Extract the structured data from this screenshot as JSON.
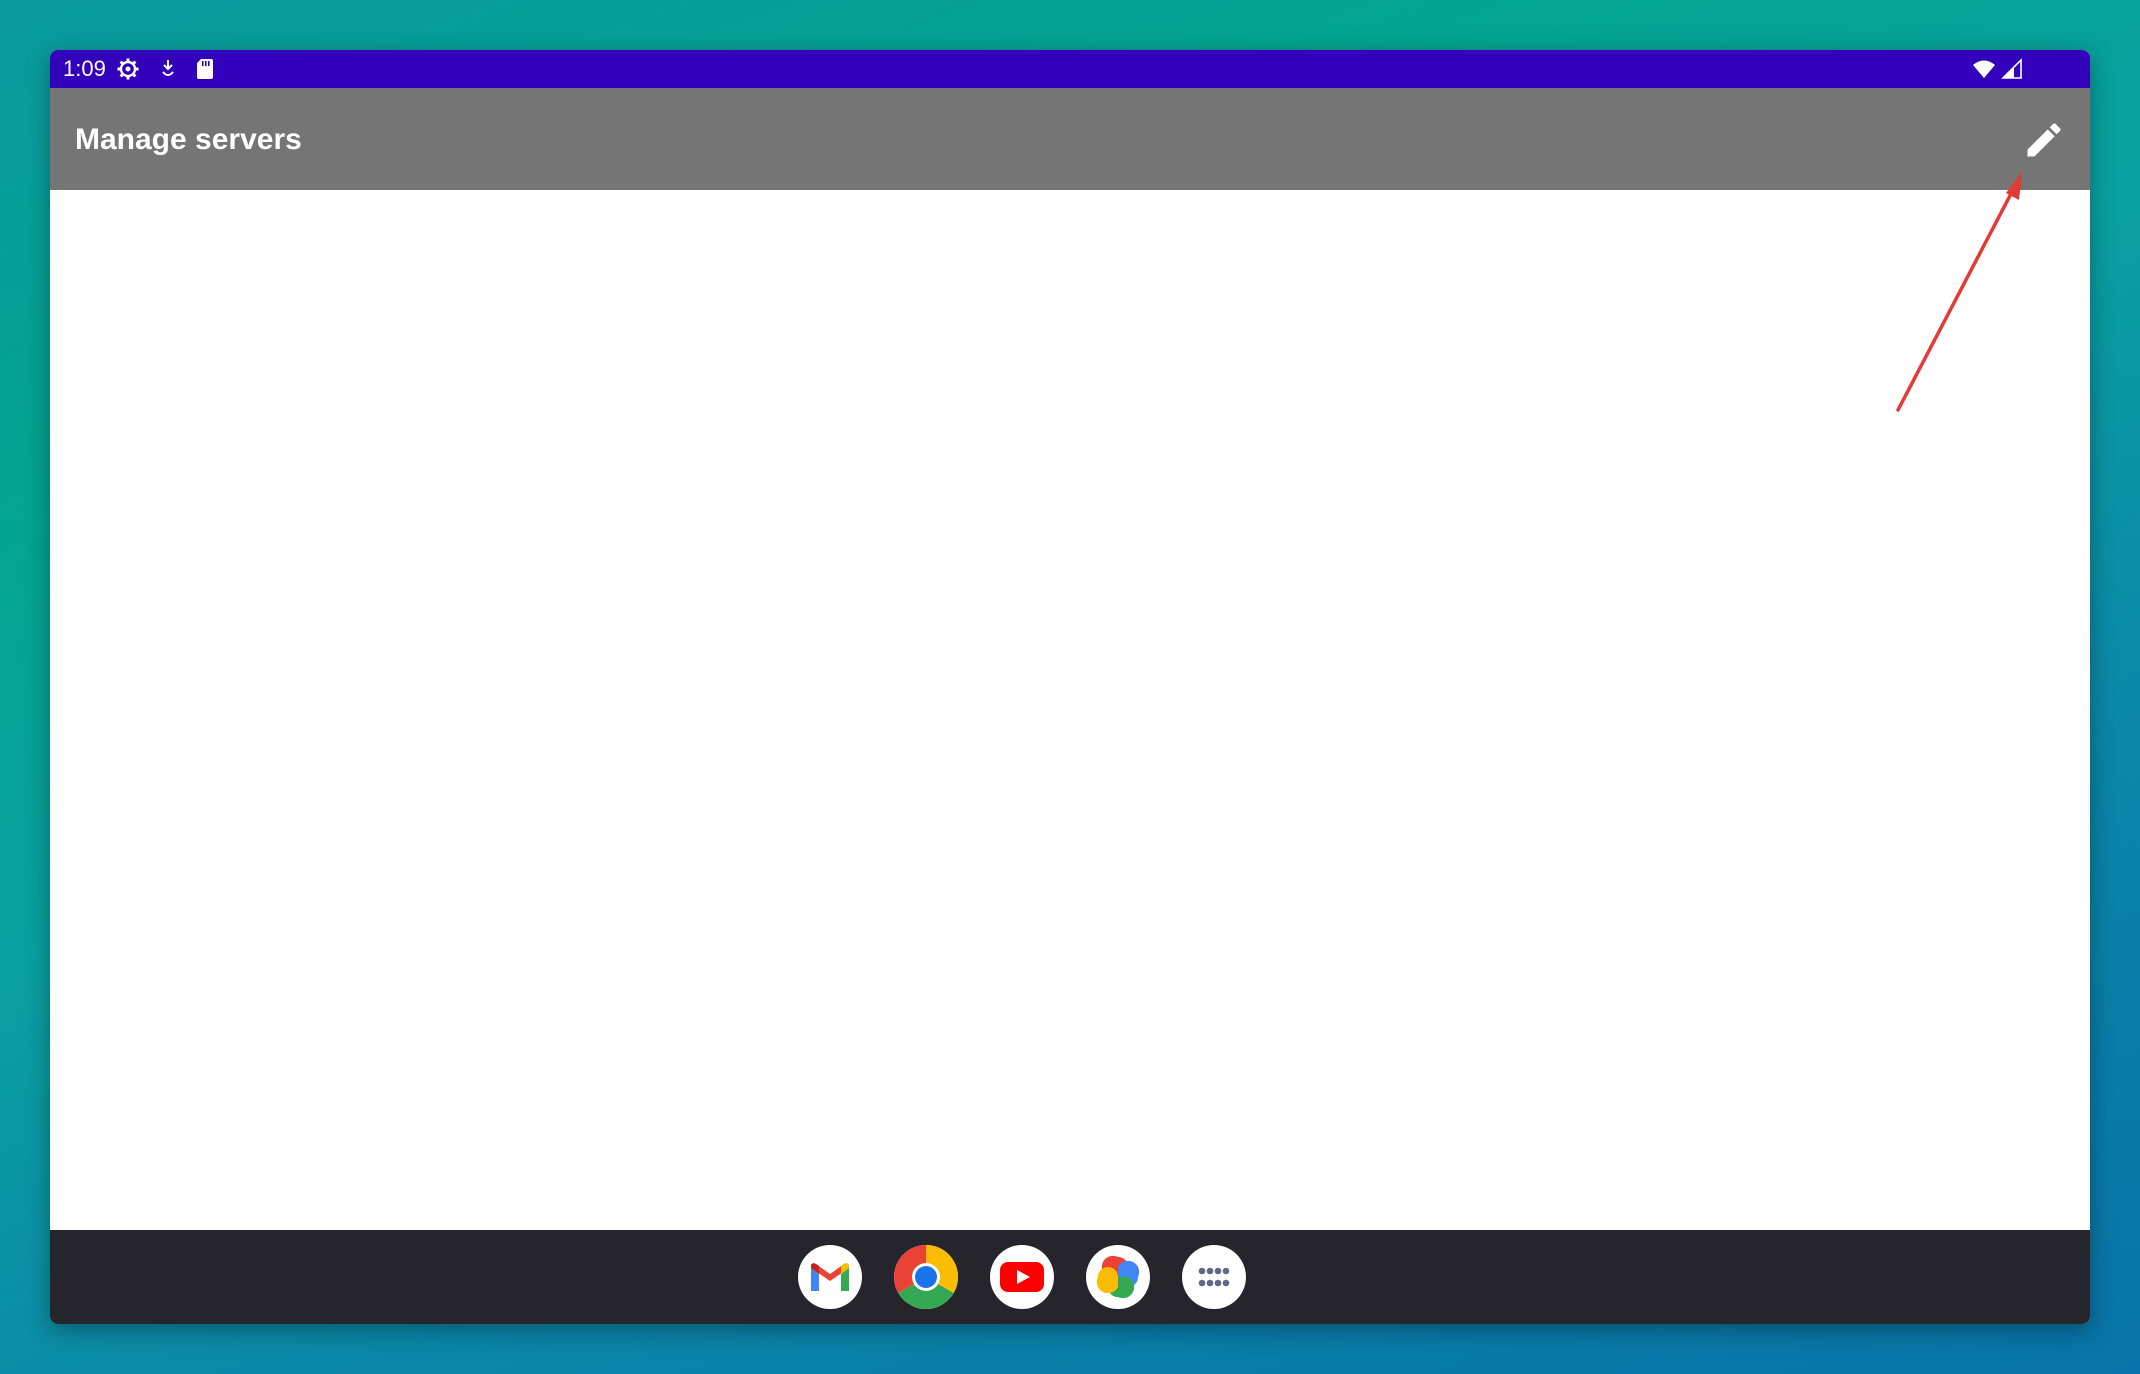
{
  "status_bar": {
    "time": "1:09",
    "left_icons": [
      "settings-gear-icon",
      "download-icon",
      "sd-card-icon"
    ],
    "right_icons": [
      "wifi-icon",
      "cellular-signal-icon"
    ],
    "background_color": "#3300bb"
  },
  "app_bar": {
    "title": "Manage servers",
    "action_icon": "pencil-edit-icon",
    "background_color": "#757575"
  },
  "taskbar": {
    "apps": [
      {
        "name": "Gmail",
        "icon": "gmail-icon"
      },
      {
        "name": "Chrome",
        "icon": "chrome-icon"
      },
      {
        "name": "YouTube",
        "icon": "youtube-icon"
      },
      {
        "name": "Photos",
        "icon": "photos-icon"
      },
      {
        "name": "App drawer",
        "icon": "app-drawer-icon"
      }
    ],
    "background_color": "#26252b"
  },
  "annotation": {
    "type": "arrow",
    "color": "#e53935",
    "points_to": "edit-button"
  }
}
